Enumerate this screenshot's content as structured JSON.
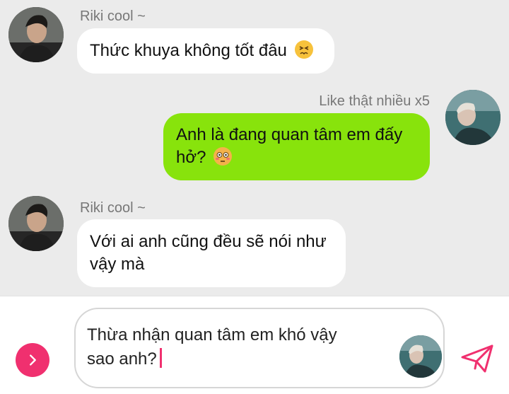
{
  "messages": [
    {
      "sender": "Riki cool ~",
      "direction": "incoming",
      "text": "Thức khuya không tốt đâu",
      "emoji": "persevering-face"
    },
    {
      "sender": "Like thật nhiều x5",
      "direction": "outgoing",
      "line1": "Anh là đang quan tâm em đấy",
      "line2": "hở?",
      "emoji": "flushed-face"
    },
    {
      "sender": "Riki cool ~",
      "direction": "incoming",
      "line1": "Với ai anh cũng đều sẽ nói như",
      "line2": "vậy mà"
    }
  ],
  "composer": {
    "line1": "Thừa nhận quan tâm em khó vậy",
    "line2": "sao anh?"
  },
  "icons": {
    "next": "chevron-right-icon",
    "send": "paper-plane-icon"
  },
  "colors": {
    "outgoing_bubble": "#88e30c",
    "incoming_bubble": "#ffffff",
    "accent": "#f0306f",
    "background": "#ebebeb"
  }
}
